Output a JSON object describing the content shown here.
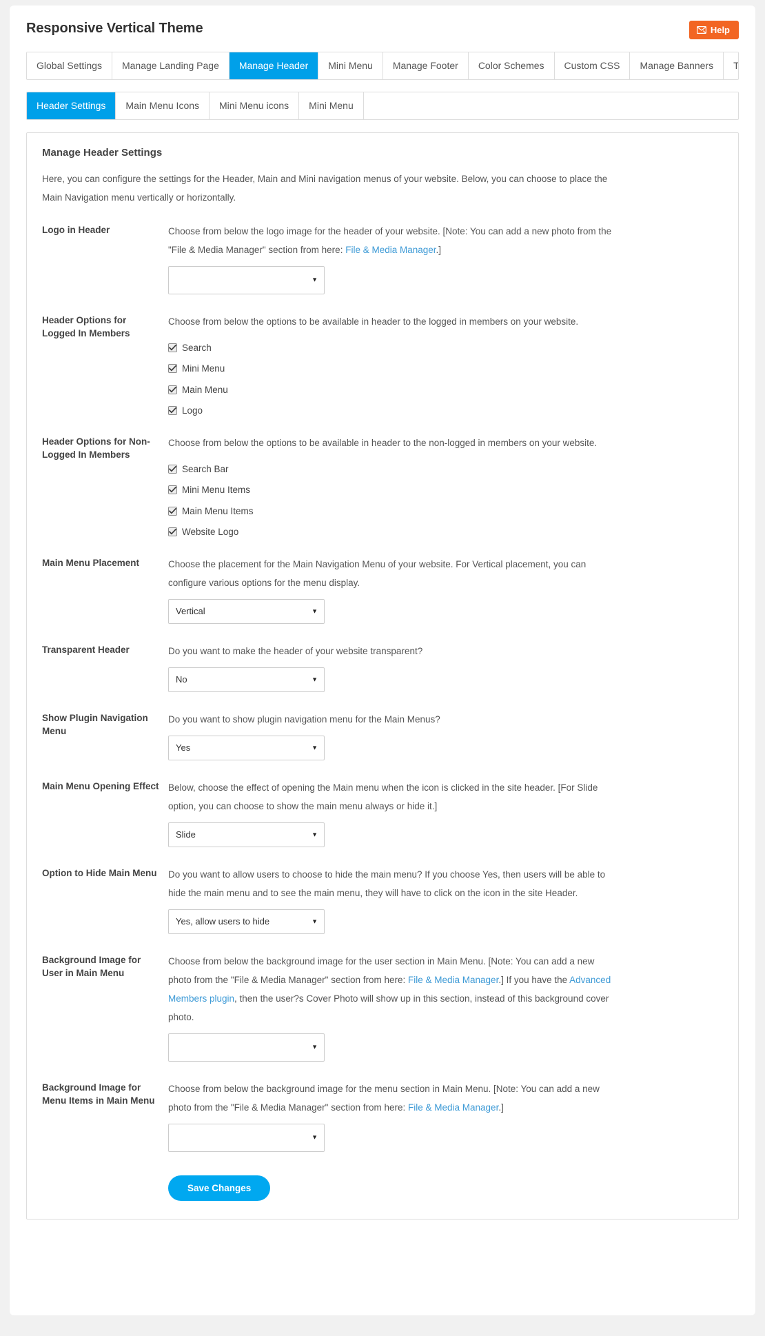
{
  "header": {
    "title": "Responsive Vertical Theme",
    "help_label": "Help",
    "help_icon": "envelope-icon",
    "help_color": "#f26522"
  },
  "tabs": [
    {
      "label": "Global Settings",
      "active": false
    },
    {
      "label": "Manage Landing Page",
      "active": false
    },
    {
      "label": "Manage Header",
      "active": true
    },
    {
      "label": "Mini Menu",
      "active": false
    },
    {
      "label": "Manage Footer",
      "active": false
    },
    {
      "label": "Color Schemes",
      "active": false
    },
    {
      "label": "Custom CSS",
      "active": false
    },
    {
      "label": "Manage Banners",
      "active": false
    },
    {
      "label": "Typography",
      "active": false
    }
  ],
  "subtabs": [
    {
      "label": "Header Settings",
      "active": true
    },
    {
      "label": "Main Menu Icons",
      "active": false
    },
    {
      "label": "Mini Menu icons",
      "active": false
    },
    {
      "label": "Mini Menu",
      "active": false
    }
  ],
  "panel": {
    "title": "Manage Header Settings",
    "intro": "Here, you can configure the settings for the Header, Main and Mini navigation menus of your website. Below, you can choose to place the Main Navigation menu vertically or horizontally.",
    "accent_color": "#00a0e9",
    "link_color": "#3d9ad6"
  },
  "rows": [
    {
      "label": "Logo in Header",
      "desc_parts": [
        {
          "text": "Choose from below the logo image for the header of your website. [Note: You can add a new photo from the \"File & Media Manager\" section from here: ",
          "link": false
        },
        {
          "text": "File & Media Manager",
          "link": true
        },
        {
          "text": ".]",
          "link": false
        }
      ],
      "select_value": ""
    },
    {
      "label": "Header Options for Logged In Members",
      "desc_parts": [
        {
          "text": "Choose from below the options to be available in header to the logged in members on your website.",
          "link": false
        }
      ],
      "checkboxes": [
        {
          "label": "Search",
          "checked": true
        },
        {
          "label": "Mini Menu",
          "checked": true
        },
        {
          "label": "Main Menu",
          "checked": true
        },
        {
          "label": "Logo",
          "checked": true
        }
      ]
    },
    {
      "label": "Header Options for Non-Logged In Members",
      "desc_parts": [
        {
          "text": "Choose from below the options to be available in header to the non-logged in members on your website.",
          "link": false
        }
      ],
      "checkboxes": [
        {
          "label": "Search Bar",
          "checked": true
        },
        {
          "label": "Mini Menu Items",
          "checked": true
        },
        {
          "label": "Main Menu Items",
          "checked": true
        },
        {
          "label": "Website Logo",
          "checked": true
        }
      ]
    },
    {
      "label": "Main Menu Placement",
      "desc_parts": [
        {
          "text": "Choose the placement for the Main Navigation Menu of your website. For Vertical placement, you can configure various options for the menu display.",
          "link": false
        }
      ],
      "select_value": "Vertical"
    },
    {
      "label": "Transparent Header",
      "desc_parts": [
        {
          "text": "Do you want to make the header of your website transparent?",
          "link": false
        }
      ],
      "select_value": "No"
    },
    {
      "label": "Show Plugin Navigation Menu",
      "desc_parts": [
        {
          "text": "Do you want to show plugin navigation menu for the Main Menus?",
          "link": false
        }
      ],
      "select_value": "Yes"
    },
    {
      "label": "Main Menu Opening Effect",
      "desc_parts": [
        {
          "text": "Below, choose the effect of opening the Main menu when the icon is clicked in the site header. [For Slide option, you can choose to show the main menu always or hide it.]",
          "link": false
        }
      ],
      "select_value": "Slide"
    },
    {
      "label": "Option to Hide Main Menu",
      "desc_parts": [
        {
          "text": "Do you want to allow users to choose to hide the main menu? If you choose Yes, then users will be able to hide the main menu and to see the main menu, they will have to click on the icon in the site Header.",
          "link": false
        }
      ],
      "select_value": "Yes, allow users to hide"
    },
    {
      "label": "Background Image for User in Main Menu",
      "desc_parts": [
        {
          "text": "Choose from below the background image for the user section in Main Menu. [Note: You can add a new photo from the \"File & Media Manager\" section from here: ",
          "link": false
        },
        {
          "text": "File & Media Manager",
          "link": true
        },
        {
          "text": ".] If you have the ",
          "link": false
        },
        {
          "text": "Advanced Members plugin",
          "link": true
        },
        {
          "text": ", then the user?s Cover Photo will show up in this section, instead of this background cover photo.",
          "link": false
        }
      ],
      "select_value": ""
    },
    {
      "label": "Background Image for Menu Items in Main Menu",
      "desc_parts": [
        {
          "text": "Choose from below the background image for the menu section in Main Menu. [Note: You can add a new photo from the \"File & Media Manager\" section from here: ",
          "link": false
        },
        {
          "text": "File & Media Manager",
          "link": true
        },
        {
          "text": ".]",
          "link": false
        }
      ],
      "select_value": ""
    }
  ],
  "footer": {
    "save_label": "Save Changes",
    "save_color": "#00a8f0"
  }
}
